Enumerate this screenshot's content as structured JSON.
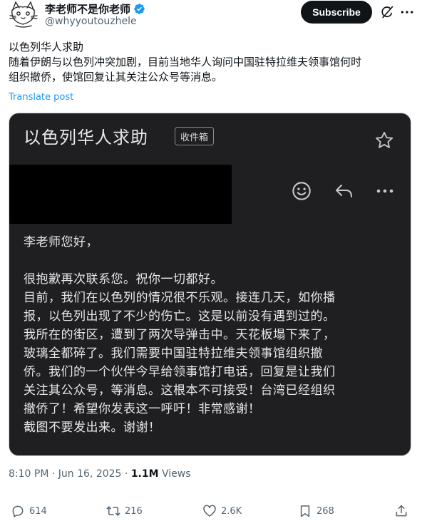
{
  "author": {
    "name": "李老师不是你老师",
    "handle": "@whyyoutouzhele",
    "verified": true
  },
  "subscribe_label": "Subscribe",
  "tweet": {
    "lines": [
      "以色列华人求助",
      "随着伊朗与以色列冲突加剧，目前当地华人询问中国驻特拉维夫领事馆何时",
      "组织撤侨，使馆回复让其关注公众号等消息。"
    ],
    "translate_label": "Translate post"
  },
  "email": {
    "subject": "以色列华人求助",
    "folder_badge": "收件箱",
    "body_lines": [
      "李老师您好，",
      "",
      "很抱歉再次联系您。祝你一切都好。",
      "目前，我们在以色列的情况很不乐观。接连几天，如你播",
      "报，以色列出现了不少的伤亡。这是以前没有遇到过的。",
      "我所在的街区，遭到了两次导弹击中。天花板塌下来了，",
      "玻璃全都碎了。我们需要中国驻特拉维夫领事馆组织撤",
      "侨。我们的一个伙伴今早给领事馆打电话，回复是让我们",
      "关注其公众号，等消息。这根本不可接受！台湾已经组织",
      "撤侨了！希望你发表这一呼吁！非常感谢！",
      "截图不要发出来。谢谢！"
    ]
  },
  "meta": {
    "time": "8:10 PM",
    "separator": " · ",
    "date": "Jun 16, 2025",
    "views_count": "1.1M",
    "views_label": " Views"
  },
  "actions": {
    "replies": "614",
    "reposts": "216",
    "likes": "2.6K",
    "bookmarks": "268"
  },
  "colors": {
    "accent": "#1d9bf0",
    "card_bg": "#1f1f22"
  }
}
